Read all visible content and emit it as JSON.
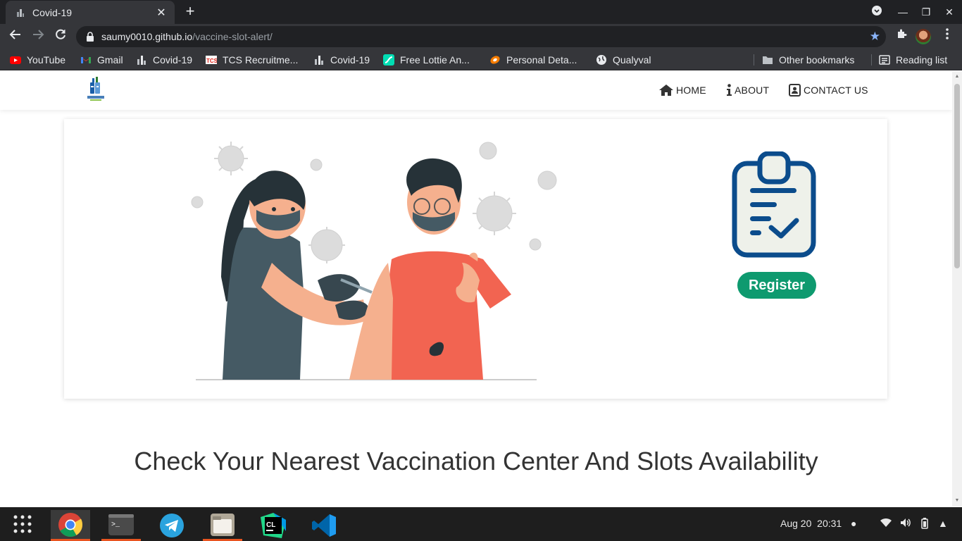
{
  "browser": {
    "tab_title": "Covid-19",
    "tab_close": "✕",
    "new_tab": "+",
    "url_host": "saumy0010.github.io",
    "url_path": "/vaccine-slot-alert/",
    "win_minimize": "—",
    "win_maximize": "❐",
    "win_close": "✕"
  },
  "bookmarks": [
    {
      "label": "YouTube",
      "icon": "youtube-icon"
    },
    {
      "label": "Gmail",
      "icon": "gmail-icon"
    },
    {
      "label": "Covid-19",
      "icon": "covid-icon"
    },
    {
      "label": "TCS Recruitme...",
      "icon": "tcs-icon"
    },
    {
      "label": "Covid-19",
      "icon": "covid-icon"
    },
    {
      "label": "Free Lottie An...",
      "icon": "lottie-icon"
    },
    {
      "label": "Personal Deta...",
      "icon": "personal-icon"
    },
    {
      "label": "Qualyval",
      "icon": "globe-icon"
    }
  ],
  "bookmarks_right": {
    "other": "Other bookmarks",
    "reading": "Reading list"
  },
  "site": {
    "nav": [
      {
        "label": "HOME",
        "icon": "home-icon"
      },
      {
        "label": "ABOUT",
        "icon": "info-icon"
      },
      {
        "label": "CONTACT US",
        "icon": "contact-icon"
      }
    ],
    "register_label": "Register",
    "heading": "Check Your Nearest Vaccination Center And Slots Availability"
  },
  "taskbar": {
    "date": "Aug 20",
    "time": "20:31",
    "apps": [
      "chrome-icon",
      "terminal-icon",
      "telegram-icon",
      "files-icon",
      "clion-icon",
      "vscode-icon"
    ]
  },
  "colors": {
    "chrome_dark": "#202124",
    "chrome_toolbar": "#35363a",
    "register_green": "#0e9a6f",
    "clipboard_blue": "#0b4c8c",
    "shirt_red": "#f26451"
  }
}
